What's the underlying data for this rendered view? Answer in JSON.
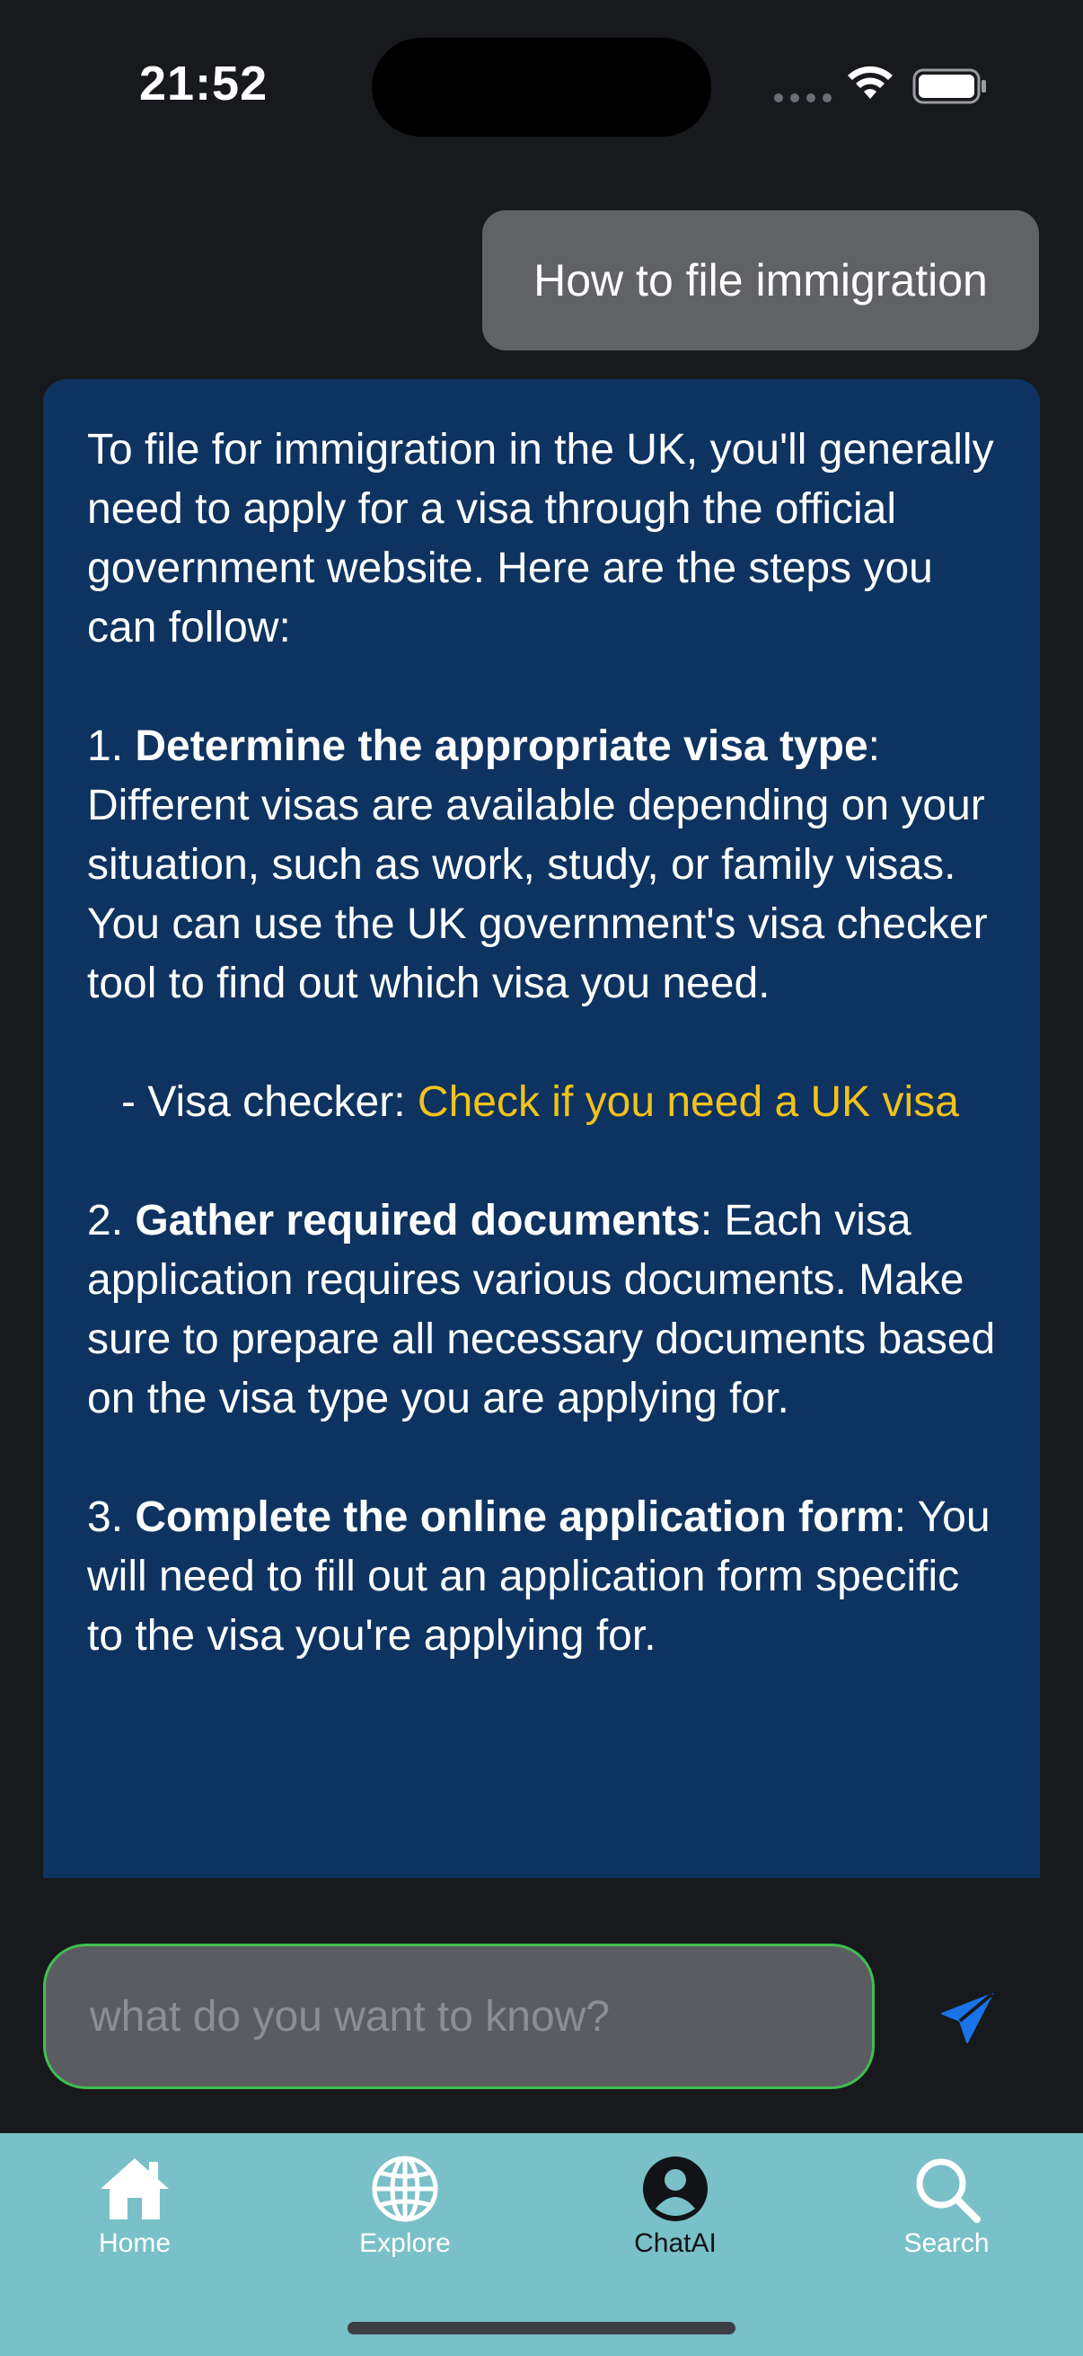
{
  "status_bar": {
    "time": "21:52",
    "icons": [
      "signal-icon",
      "wifi-icon",
      "battery-icon"
    ]
  },
  "chat": {
    "user_message": "How to file immigration",
    "assistant": {
      "intro": "To file for immigration in the UK, you'll generally need to apply for a visa through the official government website. Here are the steps you can follow:",
      "step1_num": "1. ",
      "step1_title": "Determine the appropriate visa type",
      "step1_body": ": Different visas are available depending on your situation, such as work, study, or family visas. You can use the UK government's visa checker tool to find out which visa you need.",
      "visa_checker_prefix": "- Visa checker: ",
      "visa_checker_link": "Check if you need a UK visa",
      "step2_num": "2. ",
      "step2_title": "Gather required documents",
      "step2_body": ": Each visa application requires various documents. Make sure to prepare all necessary documents based on the visa type you are applying for.",
      "step3_num": "3. ",
      "step3_title": "Complete the online application form",
      "step3_body": ": You will need to fill out an application form specific to the visa you're applying for."
    }
  },
  "composer": {
    "placeholder": "what do you want to know?",
    "send_icon": "send-icon"
  },
  "tabs": [
    {
      "label": "Home",
      "icon": "home-icon",
      "active": false
    },
    {
      "label": "Explore",
      "icon": "globe-icon",
      "active": false
    },
    {
      "label": "ChatAI",
      "icon": "person-icon",
      "active": true
    },
    {
      "label": "Search",
      "icon": "search-icon",
      "active": false
    }
  ],
  "colors": {
    "background": "#17191d",
    "user_bubble": "#616266",
    "assistant_bubble": "#0e3361",
    "link": "#f2c21b",
    "input_border": "#3fbf4e",
    "send": "#1a73e8",
    "tab_bar": "#7ac0c8"
  }
}
